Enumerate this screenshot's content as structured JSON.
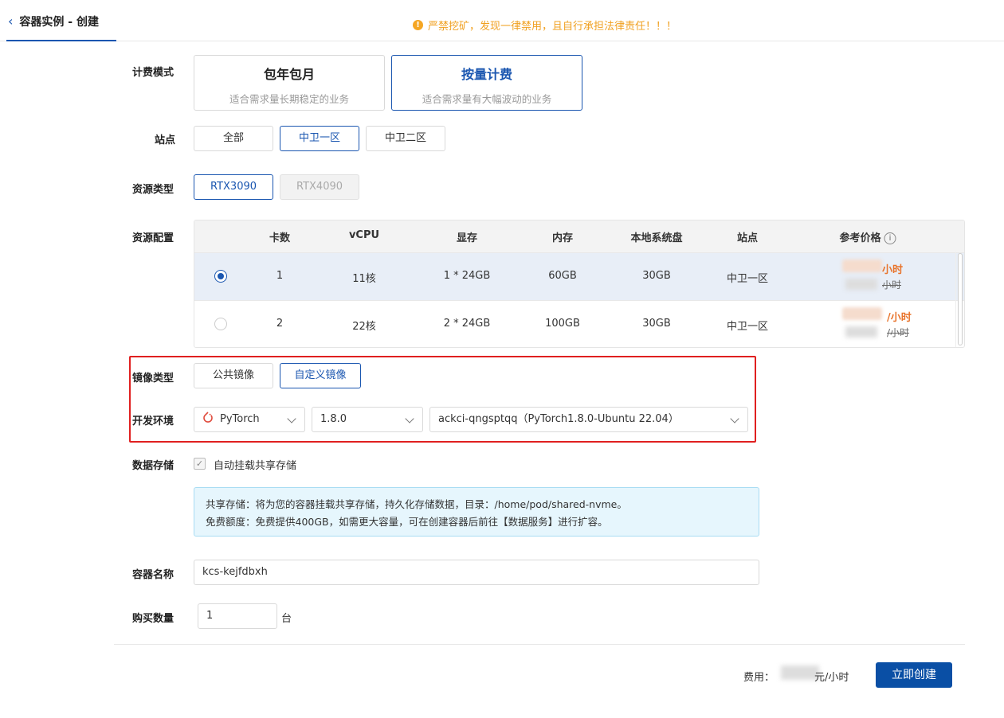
{
  "header": {
    "back_icon": "chevron-left-icon",
    "title": "容器实例 - 创建",
    "warning": "严禁挖矿，发现一律禁用，且自行承担法律责任！！！",
    "warning_icon": "exclamation-circle-icon"
  },
  "labels": {
    "billing_mode": "计费模式",
    "site": "站点",
    "resource_type": "资源类型",
    "resource_config": "资源配置",
    "image_type": "镜像类型",
    "dev_env": "开发环境",
    "data_storage": "数据存储",
    "container_name": "容器名称",
    "purchase_qty": "购买数量"
  },
  "billing_modes": [
    {
      "title": "包年包月",
      "desc": "适合需求量长期稳定的业务",
      "active": false
    },
    {
      "title": "按量计费",
      "desc": "适合需求量有大幅波动的业务",
      "active": true
    }
  ],
  "sites": [
    {
      "label": "全部",
      "active": false
    },
    {
      "label": "中卫一区",
      "active": true
    },
    {
      "label": "中卫二区",
      "active": false
    }
  ],
  "resource_types": [
    {
      "label": "RTX3090",
      "active": true,
      "disabled": false
    },
    {
      "label": "RTX4090",
      "active": false,
      "disabled": true
    }
  ],
  "table": {
    "headers": [
      "卡数",
      "vCPU",
      "显存",
      "内存",
      "本地系统盘",
      "站点",
      "参考价格"
    ],
    "rows": [
      {
        "selected": true,
        "cards": "1",
        "vcpu": "11核",
        "vram": "1 * 24GB",
        "mem": "60GB",
        "disk": "30GB",
        "site": "中卫一区",
        "price_main": "小时",
        "price_orig": "小时"
      },
      {
        "selected": false,
        "cards": "2",
        "vcpu": "22核",
        "vram": "2 * 24GB",
        "mem": "100GB",
        "disk": "30GB",
        "site": "中卫一区",
        "price_main": "/小时",
        "price_orig": "/小时"
      }
    ]
  },
  "image_types": [
    {
      "label": "公共镜像",
      "active": false
    },
    {
      "label": "自定义镜像",
      "active": true
    }
  ],
  "dev_env": {
    "framework": "PyTorch",
    "framework_icon": "pytorch-flame-icon",
    "version": "1.8.0",
    "image": "ackci-qngsptqq（PyTorch1.8.0-Ubuntu 22.04）"
  },
  "storage": {
    "checkbox_label": "自动挂载共享存储",
    "checked": true,
    "info_line1": "共享存储：将为您的容器挂载共享存储，持久化存储数据，目录：/home/pod/shared-nvme。",
    "info_line2": "免费额度：免费提供400GB，如需更大容量，可在创建容器后前往【数据服务】进行扩容。"
  },
  "container_name": "kcs-kejfdbxh",
  "quantity": {
    "value": "1",
    "unit": "台"
  },
  "footer": {
    "fee_label": "费用：",
    "fee_unit": "元/小时",
    "create_button": "立即创建"
  },
  "colors": {
    "primary": "#1a56b0",
    "warning": "#f0a020",
    "price": "#e8742c",
    "highlight_box": "#e02020"
  }
}
